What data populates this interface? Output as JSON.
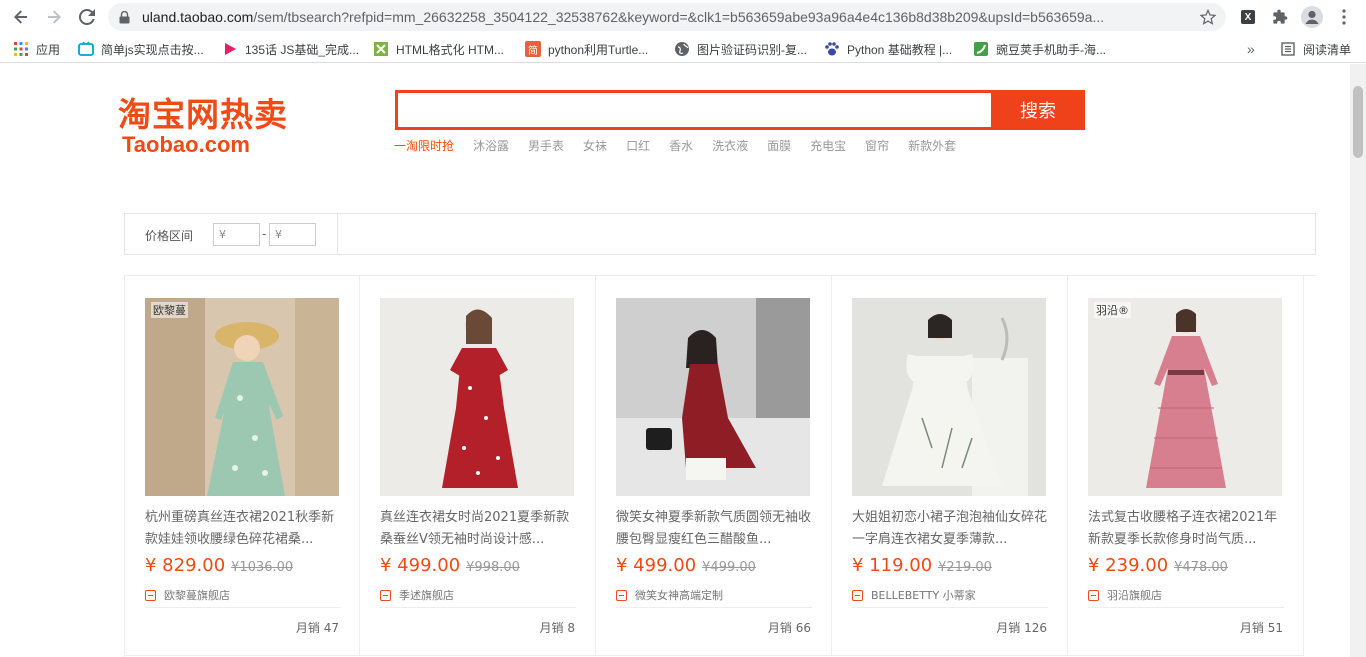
{
  "browser": {
    "url_host": "uland.taobao.com",
    "url_rest": "/sem/tbsearch?refpid=mm_26632258_3504122_32538762&keyword=&clk1=b563659abe93a96a4e4c136b8d38b209&upsId=b563659a..."
  },
  "bookmarks": [
    {
      "label": "应用",
      "icon": "apps-grid-icon",
      "color": "#4285f4"
    },
    {
      "label": "简单js实现点击按...",
      "icon": "bookmark-tv-icon",
      "color": "#00a1d6"
    },
    {
      "label": "135话 JS基础_完成...",
      "icon": "bookmark-play-icon",
      "color": "#e91e63"
    },
    {
      "label": "HTML格式化 HTM...",
      "icon": "bookmark-puzzle-icon",
      "color": "#7cb342"
    },
    {
      "label": "python利用Turtle...",
      "icon": "bookmark-jian-icon",
      "color": "#e8603c"
    },
    {
      "label": "图片验证码识别-复...",
      "icon": "bookmark-globe-icon",
      "color": "#5f6368"
    },
    {
      "label": "Python 基础教程 |...",
      "icon": "bookmark-paw-icon",
      "color": "#3949ab"
    },
    {
      "label": "豌豆荚手机助手-海...",
      "icon": "bookmark-pea-icon",
      "color": "#43a047"
    }
  ],
  "reading_list": "阅读清单",
  "logo": {
    "cn": "淘宝网热卖",
    "en": "Taobao.com"
  },
  "search": {
    "button": "搜索",
    "value": ""
  },
  "hotwords": [
    {
      "label": "一淘限时抢",
      "active": true
    },
    {
      "label": "沐浴露",
      "active": false
    },
    {
      "label": "男手表",
      "active": false
    },
    {
      "label": "女袜",
      "active": false
    },
    {
      "label": "口红",
      "active": false
    },
    {
      "label": "香水",
      "active": false
    },
    {
      "label": "洗衣液",
      "active": false
    },
    {
      "label": "面膜",
      "active": false
    },
    {
      "label": "充电宝",
      "active": false
    },
    {
      "label": "窗帘",
      "active": false
    },
    {
      "label": "新款外套",
      "active": false
    }
  ],
  "filter": {
    "label": "价格区间",
    "min_placeholder": "¥",
    "max_placeholder": "¥",
    "dash": "-"
  },
  "products": [
    {
      "title": "杭州重磅真丝连衣裙2021秋季新款娃娃领收腰绿色碎花裙桑...",
      "price": "¥ 829.00",
      "old_price": "¥1036.00",
      "shop": "欧黎蔓旗舰店",
      "sales": "月销 47",
      "img": "dress-floral-green",
      "img_brand": "欧黎蔓"
    },
    {
      "title": "真丝连衣裙女时尚2021夏季新款桑蚕丝V领无袖时尚设计感...",
      "price": "¥ 499.00",
      "old_price": "¥998.00",
      "shop": "季述旗舰店",
      "sales": "月销 8",
      "img": "dress-red-floral"
    },
    {
      "title": "微笑女神夏季新款气质圆领无袖收腰包臀显瘦红色三醋酸鱼...",
      "price": "¥ 499.00",
      "old_price": "¥499.00",
      "shop": "微笑女神高端定制",
      "sales": "月销 66",
      "img": "dress-red-sleeveless"
    },
    {
      "title": "大姐姐初恋小裙子泡泡袖仙女碎花一字肩连衣裙女夏季薄款...",
      "price": "¥ 119.00",
      "old_price": "¥219.00",
      "shop": "BELLEBETTY 小蒂家",
      "sales": "月销 126",
      "img": "dress-white-offshoulder"
    },
    {
      "title": "法式复古收腰格子连衣裙2021年新款夏季长款修身时尚气质...",
      "price": "¥ 239.00",
      "old_price": "¥478.00",
      "shop": "羽沿旗舰店",
      "sales": "月销 51",
      "img": "dress-pink-plaid",
      "img_brand": "羽沿®"
    }
  ]
}
